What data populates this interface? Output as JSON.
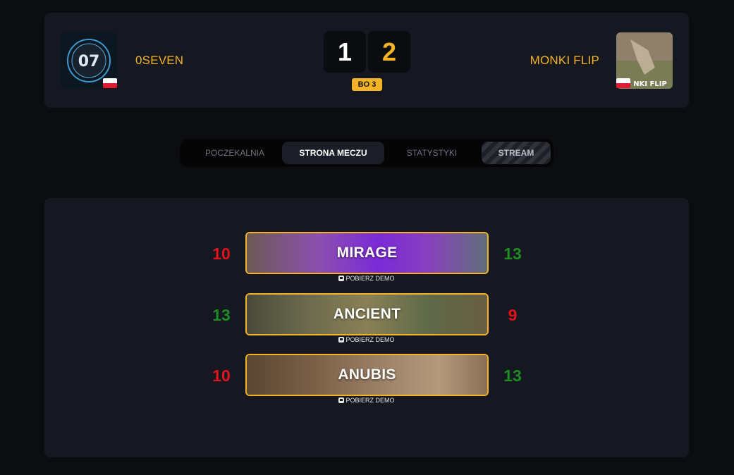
{
  "match": {
    "team_left": {
      "name": "0SEVEN",
      "logo_text": "07",
      "flag": "pl"
    },
    "team_right": {
      "name": "MONKI FLIP",
      "logo_text": "NKI FLIP",
      "flag": "pl"
    },
    "score_left": "1",
    "score_right": "2",
    "format": "BO 3"
  },
  "tabs": [
    {
      "label": "POCZEKALNIA",
      "active": false
    },
    {
      "label": "STRONA MECZU",
      "active": true
    },
    {
      "label": "STATYSTYKI",
      "active": false
    },
    {
      "label": "STREAM",
      "active": false
    }
  ],
  "maps": [
    {
      "name": "MIRAGE",
      "score_left": "10",
      "score_right": "13",
      "demo_label": "POBIERZ DEMO"
    },
    {
      "name": "ANCIENT",
      "score_left": "13",
      "score_right": "9",
      "demo_label": "POBIERZ DEMO"
    },
    {
      "name": "ANUBIS",
      "score_left": "10",
      "score_right": "13",
      "demo_label": "POBIERZ DEMO"
    }
  ],
  "colors": {
    "accent": "#f4b324",
    "loss": "#e0141d",
    "win": "#1e8c22",
    "background": "#0c0d10",
    "card": "#151820"
  },
  "icons": [
    "save-icon"
  ]
}
